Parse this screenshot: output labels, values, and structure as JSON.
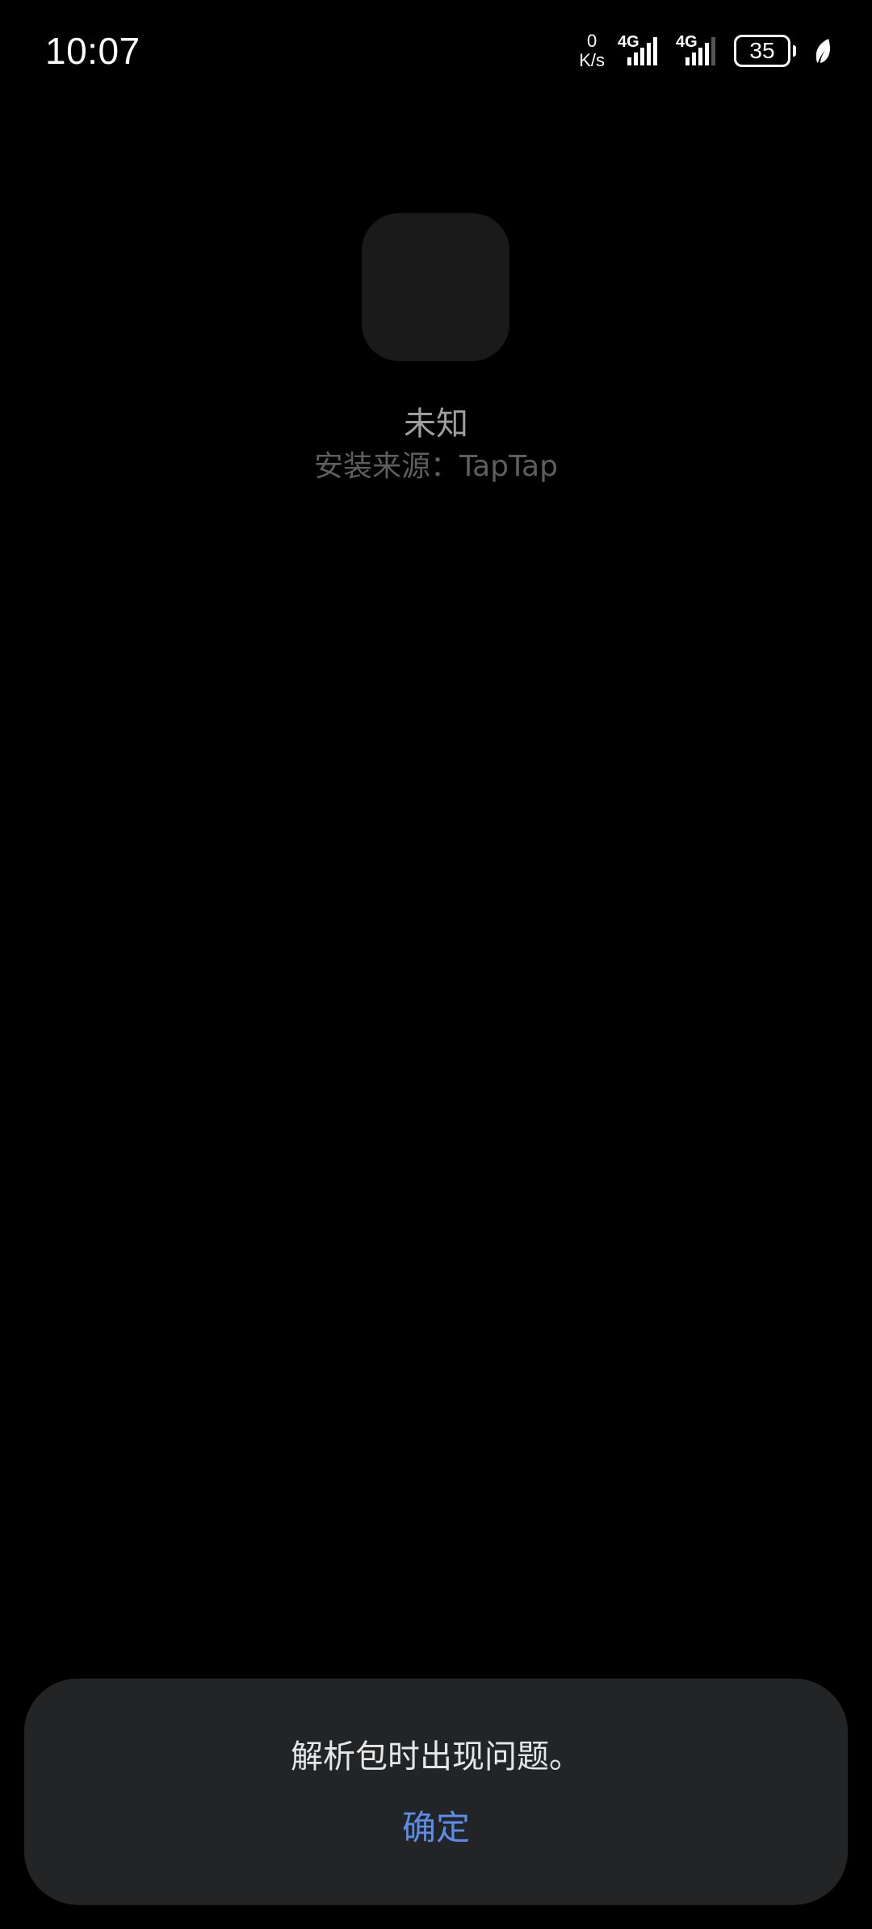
{
  "status_bar": {
    "time": "10:07",
    "net_speed_value": "0",
    "net_speed_unit": "K/s",
    "sim1_tag": "4G",
    "sim2_tag": "4G",
    "battery_level": "35",
    "icons": [
      "signal-icon",
      "signal-icon",
      "battery-icon",
      "leaf-icon"
    ]
  },
  "app": {
    "name": "未知",
    "source": "安装来源：TapTap"
  },
  "dialog": {
    "message": "解析包时出现问题。",
    "confirm_label": "确定"
  },
  "colors": {
    "background": "#000000",
    "dialog_bg": "#222426",
    "accent": "#5b8de8"
  }
}
